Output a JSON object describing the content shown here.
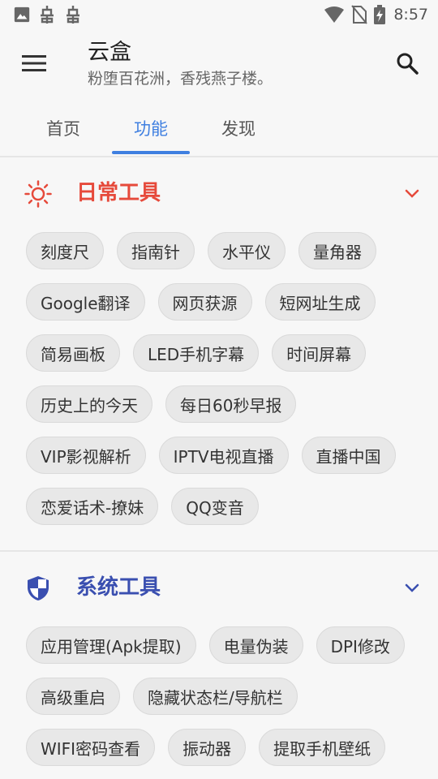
{
  "status_bar": {
    "time": "8:57",
    "left_icons": [
      "image-icon",
      "bug-icon",
      "bug-icon"
    ],
    "right_icons": [
      "wifi-icon",
      "no-sim-icon",
      "battery-charging-icon"
    ]
  },
  "app_bar": {
    "title": "云盒",
    "subtitle": "粉堕百花洲，香残燕子楼。",
    "menu_icon": "menu-icon",
    "search_icon": "search-icon"
  },
  "tabs": [
    {
      "label": "首页",
      "active": false
    },
    {
      "label": "功能",
      "active": true
    },
    {
      "label": "发现",
      "active": false
    }
  ],
  "accent_color": "#3f7fe0",
  "sections": [
    {
      "title": "日常工具",
      "icon": "sun-icon",
      "color": "#e64a3b",
      "items": [
        "刻度尺",
        "指南针",
        "水平仪",
        "量角器",
        "Google翻译",
        "网页获源",
        "短网址生成",
        "简易画板",
        "LED手机字幕",
        "时间屏幕",
        "历史上的今天",
        "每日60秒早报",
        "VIP影视解析",
        "IPTV电视直播",
        "直播中国",
        "恋爱话术-撩妹",
        "QQ变音"
      ]
    },
    {
      "title": "系统工具",
      "icon": "shield-icon",
      "color": "#3a4fb0",
      "items": [
        "应用管理(Apk提取)",
        "电量伪装",
        "DPI修改",
        "高级重启",
        "隐藏状态栏/导航栏",
        "WIFI密码查看",
        "振动器",
        "提取手机壁纸"
      ]
    }
  ]
}
